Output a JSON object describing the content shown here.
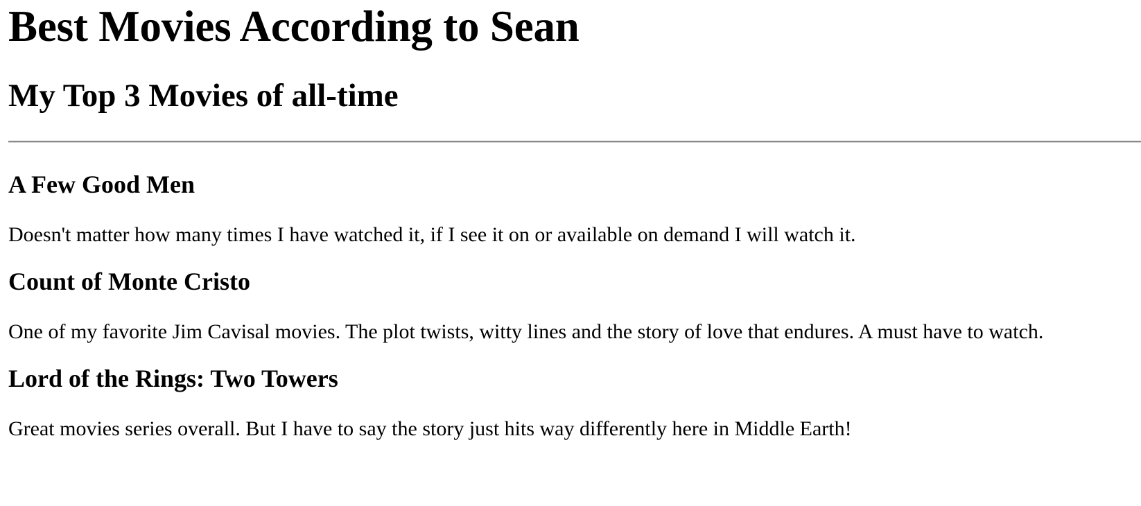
{
  "header": {
    "title": "Best Movies According to Sean",
    "subtitle": "My Top 3 Movies of all-time"
  },
  "movies": [
    {
      "title": "A Few Good Men",
      "description": "Doesn't matter how many times I have watched it, if I see it on or available on demand I will watch it."
    },
    {
      "title": "Count of Monte Cristo",
      "description": "One of my favorite Jim Cavisal movies. The plot twists, witty lines and the story of love that endures. A must have to watch."
    },
    {
      "title": "Lord of the Rings: Two Towers",
      "description": "Great movies series overall. But I have to say the story just hits way differently here in Middle Earth!"
    }
  ]
}
